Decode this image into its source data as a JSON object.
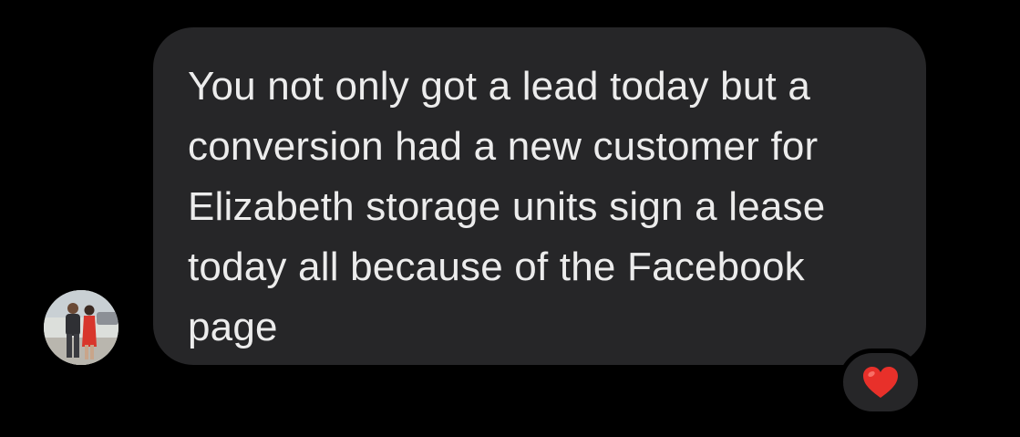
{
  "message": {
    "text": "You not only got a lead today but a\nconversion had a new customer for\nElizabeth storage units sign a lease\ntoday all because of the Facebook\npage"
  },
  "reaction": {
    "icon": "red-heart-icon",
    "color": "#e8302a"
  },
  "colors": {
    "background": "#000000",
    "bubble": "#262628",
    "text": "#ececec"
  }
}
